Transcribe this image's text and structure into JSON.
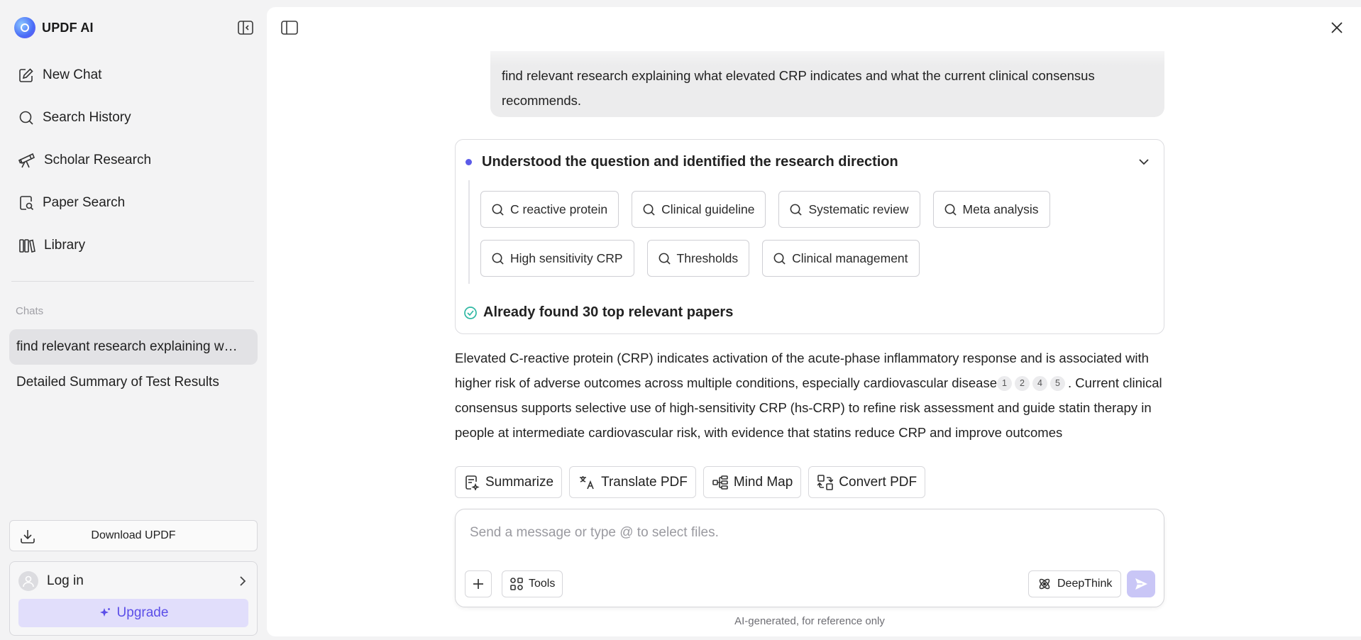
{
  "brand": {
    "title": "UPDF AI"
  },
  "sidebar": {
    "nav": [
      {
        "label": "New Chat",
        "icon": "edit-icon"
      },
      {
        "label": "Search History",
        "icon": "search-icon"
      },
      {
        "label": "Scholar Research",
        "icon": "telescope-icon"
      },
      {
        "label": "Paper Search",
        "icon": "document-search-icon"
      },
      {
        "label": "Library",
        "icon": "library-icon"
      }
    ],
    "chats_label": "Chats",
    "chats": [
      {
        "title": "find relevant research explaining what elevated CRP indicates and what the current clinical consensus recommends."
      },
      {
        "title": "Detailed Summary of Test Results"
      }
    ],
    "download_label": "Download UPDF",
    "login_label": "Log in",
    "upgrade_label": "Upgrade"
  },
  "conversation": {
    "user_message": "find relevant research explaining what elevated CRP indicates and what the current clinical consensus recommends.",
    "research": {
      "title": "Understood the question and identified the research direction",
      "keywords": [
        [
          "C reactive protein",
          "Clinical guideline",
          "Systematic review",
          "Meta analysis"
        ],
        [
          "High sensitivity CRP",
          "Thresholds",
          "Clinical management"
        ]
      ],
      "found": "Already found 30 top relevant papers"
    },
    "answer": {
      "part1": "Elevated C-reactive protein (CRP) indicates activation of the acute-phase inflammatory response and is associated with higher risk of adverse outcomes across multiple conditions, especially cardiovascular disease",
      "citations": [
        "1",
        "2",
        "4",
        "5"
      ],
      "part2": ". Current clinical consensus supports selective use of high-sensitivity CRP (hs-CRP) to refine risk assessment and guide statin therapy in people at intermediate cardiovascular risk, with evidence that statins reduce CRP and improve outcomes"
    },
    "actions": [
      {
        "label": "Summarize",
        "icon": "summarize-icon"
      },
      {
        "label": "Translate PDF",
        "icon": "translate-icon"
      },
      {
        "label": "Mind Map",
        "icon": "mind-map-icon"
      },
      {
        "label": "Convert PDF",
        "icon": "convert-icon"
      }
    ]
  },
  "composer": {
    "placeholder": "Send a message or type @ to select files.",
    "value": "",
    "tools_label": "Tools",
    "deepthink_label": "DeepThink"
  },
  "disclaimer": "AI-generated, for reference only",
  "colors": {
    "accent": "#5b4ee8",
    "upgrade_bg": "#e1defb",
    "send_bg": "#c9c6f6",
    "found_check": "#2fb8a3"
  }
}
